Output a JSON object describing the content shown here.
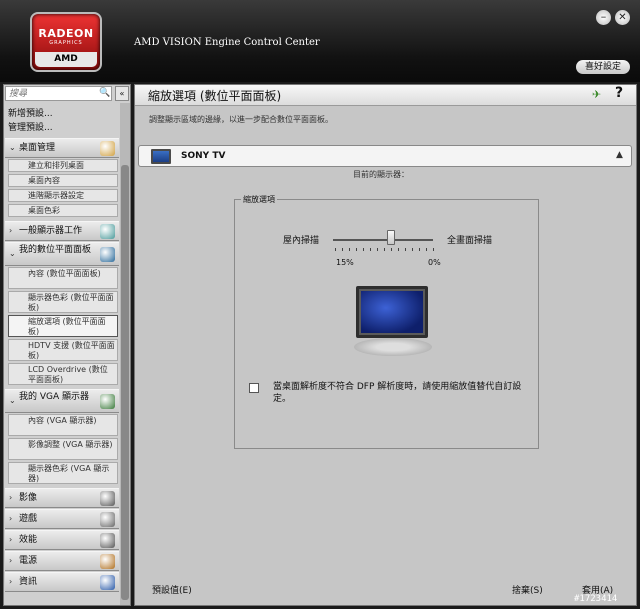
{
  "app": {
    "title": "AMD VISION Engine Control Center",
    "logo_text": "RADEON",
    "logo_sub": "GRAPHICS",
    "logo_brand": "AMD",
    "preferences_label": "喜好設定"
  },
  "sidebar": {
    "search_placeholder": "搜尋",
    "collapse_label": "«",
    "top_links": [
      "新增預設...",
      "管理預設..."
    ],
    "categories": [
      {
        "label": "桌面管理",
        "expanded": true,
        "icon": "desktop-management-icon",
        "items": [
          "建立和排列桌面",
          "桌面內容",
          "進階顯示器設定",
          "桌面色彩"
        ]
      },
      {
        "label": "一般顯示器工作",
        "expanded": false,
        "icon": "display-tasks-icon",
        "items": []
      },
      {
        "label": "我的數位平面面板",
        "expanded": true,
        "icon": "flat-panel-icon",
        "items": [
          "內容 (數位平面面板)",
          "顯示器色彩 (數位平面面板)",
          "縮放選項 (數位平面面板)",
          "HDTV 支援 (數位平面面板)",
          "LCD Overdrive (數位平面面板)"
        ]
      },
      {
        "label": "我的 VGA 顯示器",
        "expanded": true,
        "icon": "vga-display-icon",
        "items": [
          "內容 (VGA 顯示器)",
          "影像調整 (VGA 顯示器)",
          "顯示器色彩 (VGA 顯示器)"
        ]
      },
      {
        "label": "影像",
        "expanded": false,
        "icon": "video-icon",
        "items": []
      },
      {
        "label": "遊戲",
        "expanded": false,
        "icon": "gaming-icon",
        "items": []
      },
      {
        "label": "效能",
        "expanded": false,
        "icon": "performance-icon",
        "items": []
      },
      {
        "label": "電源",
        "expanded": false,
        "icon": "power-icon",
        "items": []
      },
      {
        "label": "資訊",
        "expanded": false,
        "icon": "information-icon",
        "items": []
      }
    ],
    "selected": "縮放選項 (數位平面面板)"
  },
  "main": {
    "title": "縮放選項 (數位平面面板)",
    "description": "調整顯示區域的邊緣，以進一步配合數位平面面板。",
    "display_name": "SONY TV",
    "display_sublabel": "目前的顯示器：",
    "group_title": "縮放選項",
    "underscan_label": "屋內掃描",
    "overscan_label": "全畫面掃描",
    "scale_min_label": "15%",
    "scale_max_label": "0%",
    "slider_value_fraction": 0.58,
    "checkbox_label": "當桌面解析度不符合 DFP 解析度時，請使用縮放值替代自訂設定。",
    "checkbox_checked": false
  },
  "footer": {
    "defaults": "預設值(E)",
    "discard": "捨棄(S)",
    "apply": "套用(A)"
  },
  "watermark": "#1723414",
  "colors": {
    "header_bg": "#121212",
    "sidebar_bg": "#cfcfcf",
    "main_bg": "#c6c6c6",
    "logo_red": "#cc1f1f"
  }
}
